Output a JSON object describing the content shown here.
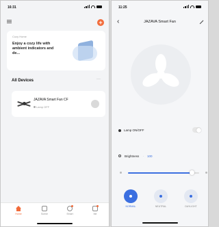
{
  "home": {
    "status_time": "16:31",
    "scene": {
      "title": "Cozy Home",
      "text": "Enjoy a cozy life with ambient indicators and de..."
    },
    "section_title": "All Devices",
    "more_label": "···",
    "device": {
      "name": "JAZAVA Smart Fan CF",
      "status": "Lamp OFF"
    },
    "tabs": [
      {
        "label": "Home",
        "active": true
      },
      {
        "label": "Scene",
        "active": false
      },
      {
        "label": "Smart",
        "active": false
      },
      {
        "label": "Me",
        "active": false
      }
    ]
  },
  "fan": {
    "status_time": "11:25",
    "title": "JAZAVA Smart Fan",
    "lamp_label": "Lamp ON/OFF",
    "lamp_on": false,
    "brightness_label": "Brightness",
    "brightness_value": "100",
    "brightness_level": 0.9,
    "modes": [
      {
        "label": "NORMAL",
        "active": true
      },
      {
        "label": "NEUTRAL",
        "active": false
      },
      {
        "label": "DAYLIGHT",
        "active": false
      }
    ]
  },
  "colors": {
    "accent": "#3b6fe0",
    "orange": "#f26b3a",
    "text": "#111111"
  }
}
